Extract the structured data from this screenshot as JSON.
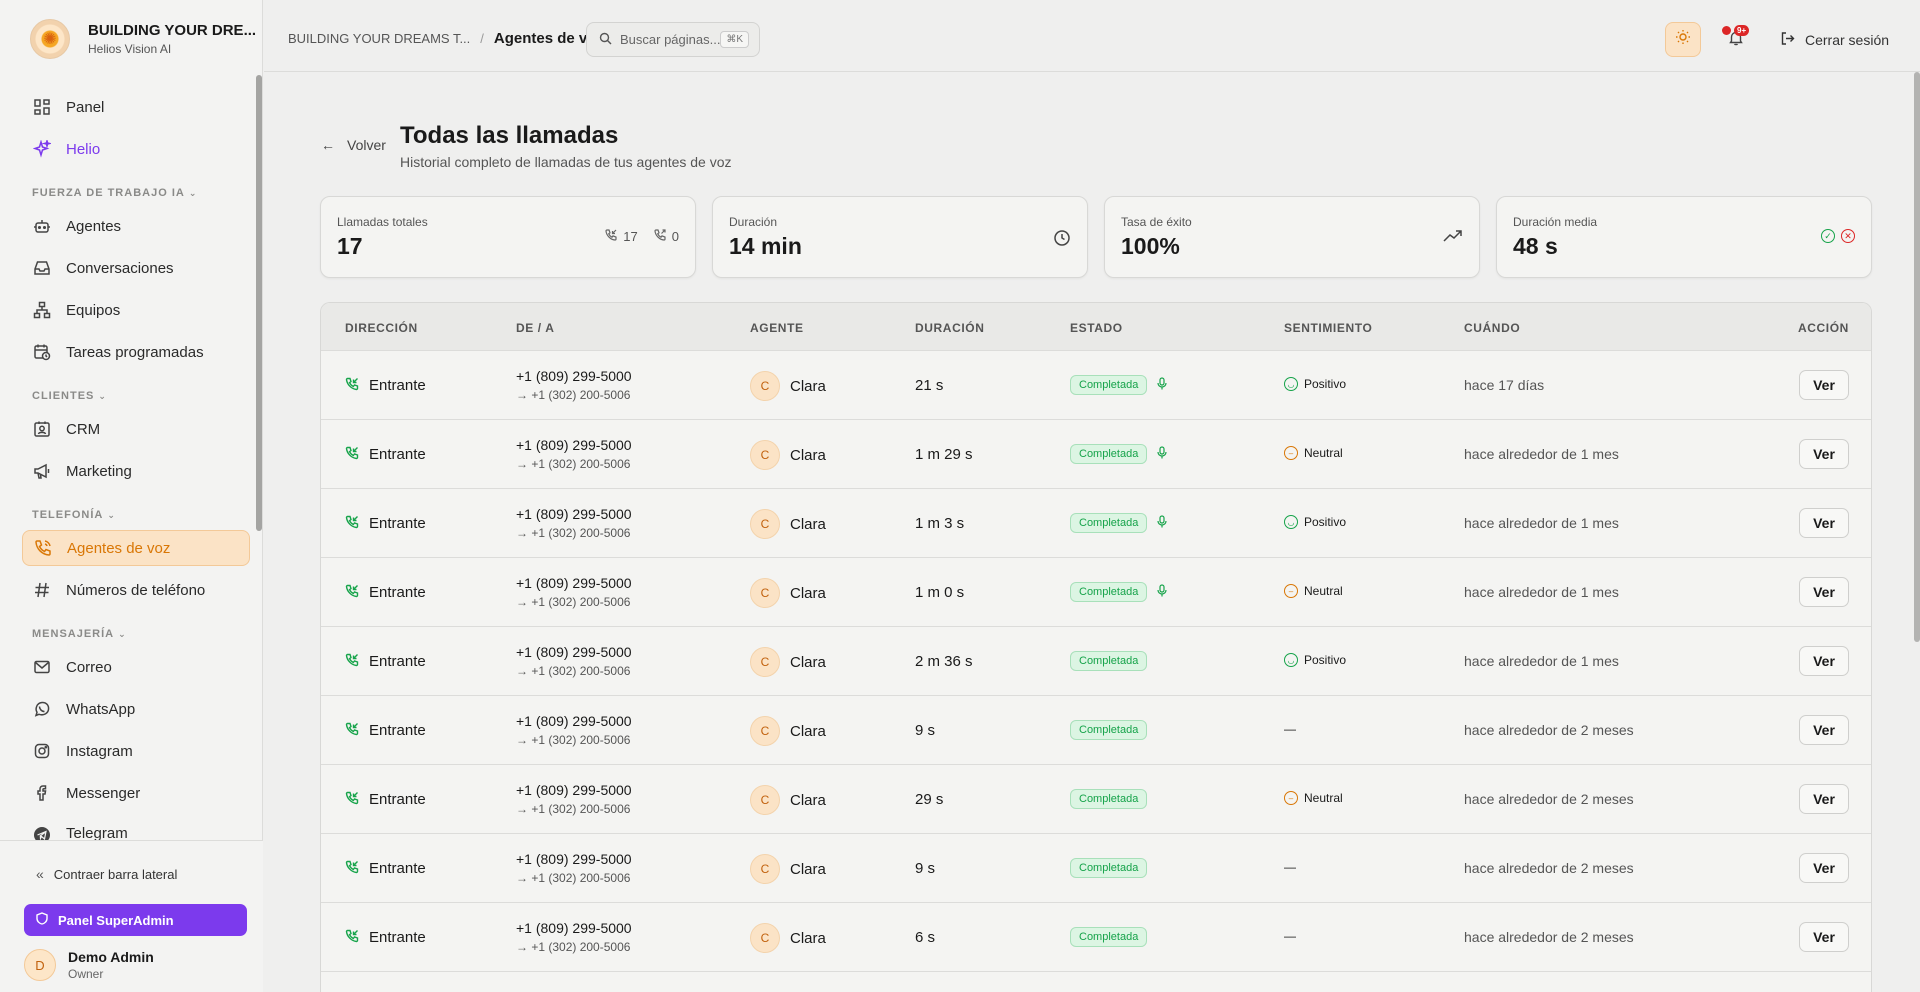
{
  "brand": {
    "title": "BUILDING YOUR DRE...",
    "subtitle": "Helios Vision AI"
  },
  "sidebar": {
    "items": [
      {
        "label": "Panel",
        "icon": "grid-icon"
      },
      {
        "label": "Helio",
        "icon": "sparkles-icon"
      },
      {
        "label": "Agentes",
        "icon": "bot-icon"
      },
      {
        "label": "Conversaciones",
        "icon": "inbox-icon"
      },
      {
        "label": "Equipos",
        "icon": "network-icon"
      },
      {
        "label": "Tareas programadas",
        "icon": "calendar-clock-icon"
      },
      {
        "label": "CRM",
        "icon": "contact-icon"
      },
      {
        "label": "Marketing",
        "icon": "megaphone-icon"
      },
      {
        "label": "Agentes de voz",
        "icon": "phone-icon"
      },
      {
        "label": "Números de teléfono",
        "icon": "hash-icon"
      },
      {
        "label": "Correo",
        "icon": "mail-icon"
      },
      {
        "label": "WhatsApp",
        "icon": "whatsapp-icon"
      },
      {
        "label": "Instagram",
        "icon": "instagram-icon"
      },
      {
        "label": "Messenger",
        "icon": "facebook-icon"
      },
      {
        "label": "Telegram",
        "icon": "telegram-icon"
      }
    ],
    "sections": {
      "workforce": "FUERZA DE TRABAJO IA",
      "clients": "CLIENTES",
      "telephony": "TELEFONÍA",
      "messaging": "MENSAJERÍA"
    },
    "collapse_label": "Contraer barra lateral",
    "superadmin_label": "Panel SuperAdmin",
    "user": {
      "initial": "D",
      "name": "Demo Admin",
      "role": "Owner"
    }
  },
  "topbar": {
    "crumb_parent": "BUILDING YOUR DREAMS T...",
    "crumb_sep": "/",
    "crumb_current": "Agentes de voz",
    "search_placeholder": "Buscar páginas...",
    "search_kbd": "⌘K",
    "notif_badge": "9+",
    "logout_label": "Cerrar sesión"
  },
  "page": {
    "back_label": "Volver",
    "title": "Todas las llamadas",
    "subtitle": "Historial completo de llamadas de tus agentes de voz"
  },
  "stats": [
    {
      "label": "Llamadas totales",
      "value": "17",
      "incoming": "17",
      "outgoing": "0"
    },
    {
      "label": "Duración",
      "value": "14 min"
    },
    {
      "label": "Tasa de éxito",
      "value": "100%"
    },
    {
      "label": "Duración media",
      "value": "48 s"
    }
  ],
  "table": {
    "headers": [
      "DIRECCIÓN",
      "DE / A",
      "AGENTE",
      "DURACIÓN",
      "ESTADO",
      "SENTIMIENTO",
      "CUÁNDO",
      "ACCIÓN"
    ],
    "rows": [
      {
        "direction": "Entrante",
        "from": "+1 (809) 299-5000",
        "to": "→ +1 (302) 200-5006",
        "agent_initial": "C",
        "agent": "Clara",
        "duration": "21 s",
        "status": "Completada",
        "recording": true,
        "sentiment": "Positivo",
        "when": "hace 17 días",
        "action": "Ver"
      },
      {
        "direction": "Entrante",
        "from": "+1 (809) 299-5000",
        "to": "→ +1 (302) 200-5006",
        "agent_initial": "C",
        "agent": "Clara",
        "duration": "1 m 29 s",
        "status": "Completada",
        "recording": true,
        "sentiment": "Neutral",
        "when": "hace alrededor de 1 mes",
        "action": "Ver"
      },
      {
        "direction": "Entrante",
        "from": "+1 (809) 299-5000",
        "to": "→ +1 (302) 200-5006",
        "agent_initial": "C",
        "agent": "Clara",
        "duration": "1 m 3 s",
        "status": "Completada",
        "recording": true,
        "sentiment": "Positivo",
        "when": "hace alrededor de 1 mes",
        "action": "Ver"
      },
      {
        "direction": "Entrante",
        "from": "+1 (809) 299-5000",
        "to": "→ +1 (302) 200-5006",
        "agent_initial": "C",
        "agent": "Clara",
        "duration": "1 m 0 s",
        "status": "Completada",
        "recording": true,
        "sentiment": "Neutral",
        "when": "hace alrededor de 1 mes",
        "action": "Ver"
      },
      {
        "direction": "Entrante",
        "from": "+1 (809) 299-5000",
        "to": "→ +1 (302) 200-5006",
        "agent_initial": "C",
        "agent": "Clara",
        "duration": "2 m 36 s",
        "status": "Completada",
        "recording": false,
        "sentiment": "Positivo",
        "when": "hace alrededor de 1 mes",
        "action": "Ver"
      },
      {
        "direction": "Entrante",
        "from": "+1 (809) 299-5000",
        "to": "→ +1 (302) 200-5006",
        "agent_initial": "C",
        "agent": "Clara",
        "duration": "9 s",
        "status": "Completada",
        "recording": false,
        "sentiment": "—",
        "when": "hace alrededor de 2 meses",
        "action": "Ver"
      },
      {
        "direction": "Entrante",
        "from": "+1 (809) 299-5000",
        "to": "→ +1 (302) 200-5006",
        "agent_initial": "C",
        "agent": "Clara",
        "duration": "29 s",
        "status": "Completada",
        "recording": false,
        "sentiment": "Neutral",
        "when": "hace alrededor de 2 meses",
        "action": "Ver"
      },
      {
        "direction": "Entrante",
        "from": "+1 (809) 299-5000",
        "to": "→ +1 (302) 200-5006",
        "agent_initial": "C",
        "agent": "Clara",
        "duration": "9 s",
        "status": "Completada",
        "recording": false,
        "sentiment": "—",
        "when": "hace alrededor de 2 meses",
        "action": "Ver"
      },
      {
        "direction": "Entrante",
        "from": "+1 (809) 299-5000",
        "to": "→ +1 (302) 200-5006",
        "agent_initial": "C",
        "agent": "Clara",
        "duration": "6 s",
        "status": "Completada",
        "recording": false,
        "sentiment": "—",
        "when": "hace alrededor de 2 meses",
        "action": "Ver"
      }
    ]
  }
}
